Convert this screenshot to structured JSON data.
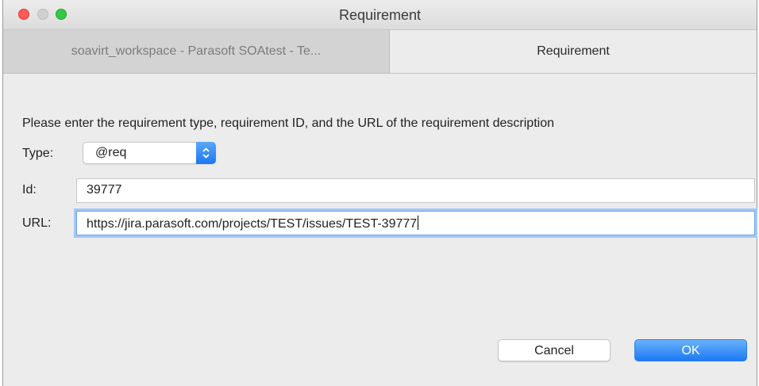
{
  "window": {
    "title": "Requirement"
  },
  "tabs": [
    {
      "label": "soavirt_workspace - Parasoft SOAtest - Te..."
    },
    {
      "label": "Requirement"
    }
  ],
  "dialog": {
    "prompt": "Please enter the requirement type, requirement ID, and the URL of the requirement description",
    "type": {
      "label": "Type:",
      "value": "@req"
    },
    "id": {
      "label": "Id:",
      "value": "39777"
    },
    "url": {
      "label": "URL:",
      "value": "https://jira.parasoft.com/projects/TEST/issues/TEST-39777"
    }
  },
  "buttons": {
    "cancel": "Cancel",
    "ok": "OK"
  },
  "colors": {
    "accent": "#1c77f1",
    "close": "#fc5b57",
    "maximize": "#35c748"
  },
  "icons": {
    "select_arrows": "updown-chevron-icon"
  }
}
